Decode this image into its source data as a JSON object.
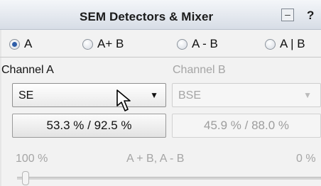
{
  "window": {
    "title": "SEM Detectors & Mixer",
    "minimize_label": "–",
    "help_label": "?"
  },
  "modes": [
    {
      "label": "A",
      "selected": true
    },
    {
      "label": "A+ B",
      "selected": false
    },
    {
      "label": "A - B",
      "selected": false
    },
    {
      "label": "A | B",
      "selected": false
    }
  ],
  "channel_a": {
    "label": "Channel A",
    "detector": "SE",
    "values": "53.3 % / 92.5 %"
  },
  "channel_b": {
    "label": "Channel B",
    "detector": "BSE",
    "values": "45.9 % / 88.0 %"
  },
  "mixer": {
    "left_label": "100 %",
    "mid_label": "A + B, A - B",
    "right_label": "0 %",
    "level_percent": 100
  },
  "icons": {
    "radio": "radio-icon",
    "dropdown": "chevron-down-icon",
    "cursor": "mouse-cursor-icon"
  },
  "colors": {
    "accent": "#2f5ea8",
    "disabled_text": "#a5a5a5"
  }
}
